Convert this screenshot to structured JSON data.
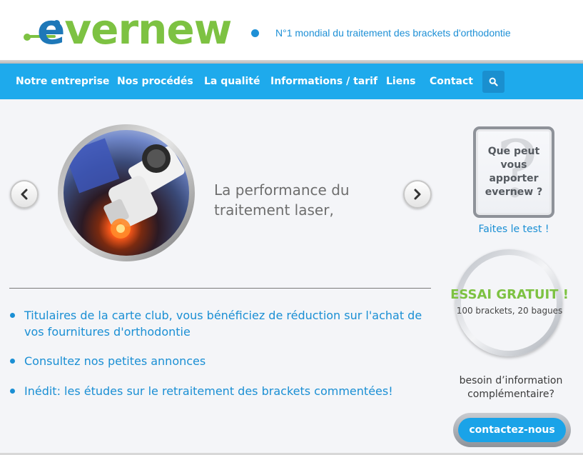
{
  "header": {
    "logo": {
      "text_e": "e",
      "text_rest": "vernew"
    },
    "tagline": "N°1 mondial du traitement des brackets d'orthodontie"
  },
  "nav": {
    "items": [
      {
        "label": "Notre entreprise"
      },
      {
        "label": "Nos procédés"
      },
      {
        "label": "La qualité"
      },
      {
        "label": "Informations / tarif"
      },
      {
        "label": "Liens"
      },
      {
        "label": "Contact"
      }
    ],
    "search_icon": "search-icon"
  },
  "slider": {
    "text": "La performance du traitement laser,",
    "prev_icon": "chevron-left-icon",
    "next_icon": "chevron-right-icon"
  },
  "bullets": [
    {
      "text": "Titulaires de la carte club, vous bénéficiez de réduction sur l'achat de vos fournitures d'orthodontie"
    },
    {
      "text": "Consultez nos petites annonces"
    },
    {
      "text": "Inédit: les études sur le retraitement des brackets commentées!"
    }
  ],
  "sidebar": {
    "question": "Que peut vous apporter evernew ?",
    "question_mark": "?",
    "test_link": "Faites le test !",
    "essai_title": "ESSAI GRATUIT !",
    "essai_subtitle": "100 brackets, 20 bagues",
    "besoin": "besoin d’information complémentaire?",
    "contact_button": "contactez-nous"
  },
  "colors": {
    "nav_bg": "#1eaaec",
    "brand_blue": "#1e78b8",
    "brand_green": "#7dc242",
    "link_blue": "#1a8fd4"
  }
}
